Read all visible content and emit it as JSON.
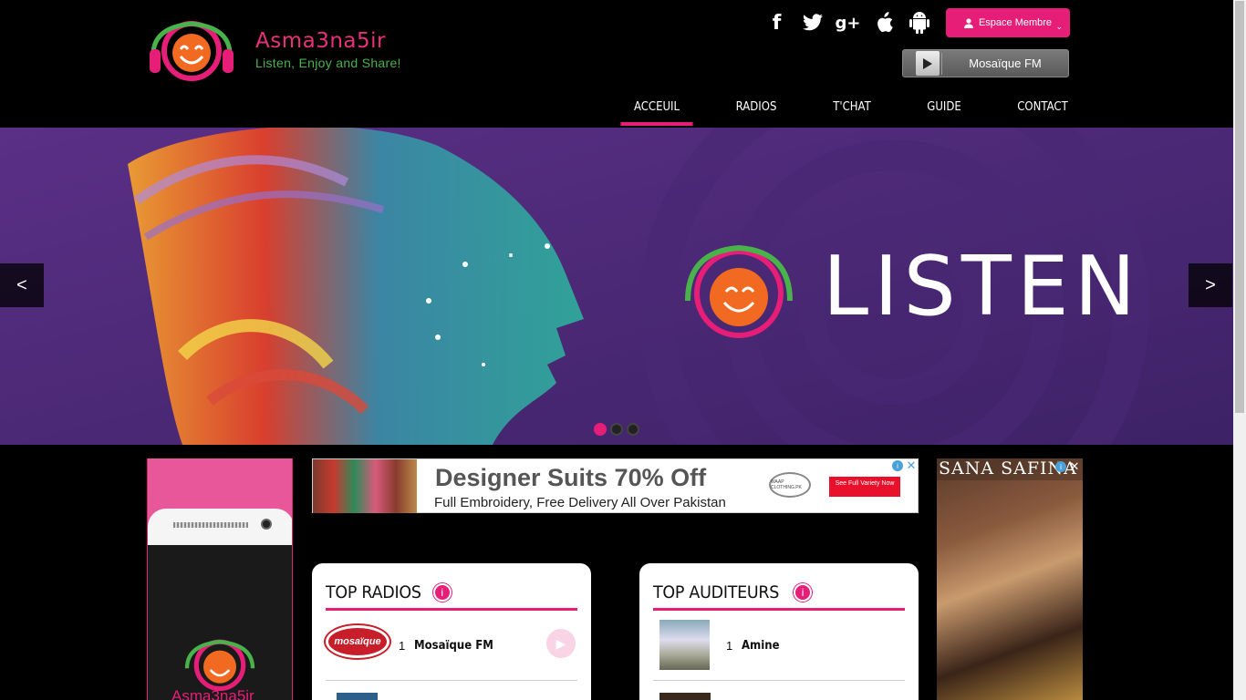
{
  "brand": {
    "name": "Asma3na5ir",
    "tagline": "Listen, Enjoy and Share!",
    "accent_color": "#e61e78",
    "green_color": "#49b24a"
  },
  "social": [
    {
      "icon": "facebook-icon",
      "glyph": "f"
    },
    {
      "icon": "twitter-icon",
      "glyph": "🐦"
    },
    {
      "icon": "google-plus-icon",
      "glyph": "g+"
    },
    {
      "icon": "apple-icon",
      "glyph": ""
    },
    {
      "icon": "android-icon",
      "glyph": "🤖"
    }
  ],
  "member": {
    "label": "Espace Membre"
  },
  "player": {
    "station": "Mosaïque FM"
  },
  "nav": [
    {
      "label": "ACCEUIL",
      "active": true
    },
    {
      "label": "RADIOS",
      "active": false
    },
    {
      "label": "T'CHAT",
      "active": false
    },
    {
      "label": "GUIDE",
      "active": false
    },
    {
      "label": "CONTACT",
      "active": false
    }
  ],
  "hero": {
    "headline": "LISTEN",
    "prev": "<",
    "next": ">",
    "slides": 3,
    "active_slide": 1
  },
  "banner_ad": {
    "headline": "Designer Suits 70% Off",
    "subline": "Full Embroidery, Free Delivery All Over Pakistan",
    "cta": "See Full Variety Now",
    "brand": "WAAP CLOTHING.PK"
  },
  "side_left_ad": {
    "title": "Asma3na5ir"
  },
  "side_right_ad": {
    "title": "SANA SAFINA"
  },
  "top_radios": {
    "title": "TOP RADIOS",
    "items": [
      {
        "rank": "1",
        "name": "Mosaïque FM",
        "logo": "mosaique"
      }
    ]
  },
  "top_auditeurs": {
    "title": "TOP AUDITEURS",
    "items": [
      {
        "rank": "1",
        "name": "Amine"
      }
    ]
  }
}
